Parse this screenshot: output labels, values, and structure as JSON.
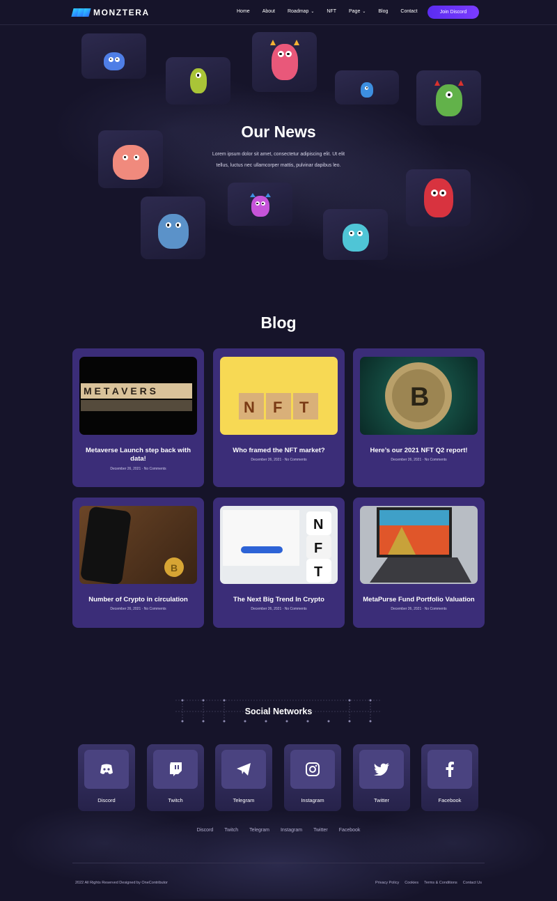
{
  "brand": {
    "name": "MONZTERA"
  },
  "nav": {
    "items": [
      {
        "label": "Home",
        "dropdown": false
      },
      {
        "label": "About",
        "dropdown": false
      },
      {
        "label": "Roadmap",
        "dropdown": true
      },
      {
        "label": "NFT",
        "dropdown": false
      },
      {
        "label": "Page",
        "dropdown": true
      },
      {
        "label": "Blog",
        "dropdown": false
      },
      {
        "label": "Contact",
        "dropdown": false
      }
    ],
    "cta": "Join Discord"
  },
  "news": {
    "title": "Our News",
    "description": "Lorem ipsum dolor sit amet, consectetur adipiscing elit. Ut elit tellus, luctus nec ullamcorper mattis, pulvinar dapibus leo."
  },
  "blog": {
    "title": "Blog",
    "posts": [
      {
        "title": "Metaverse Launch step back with data!",
        "date": "December 26, 2021",
        "comments": "No Comments",
        "image": "metaverse-blocks"
      },
      {
        "title": "Who framed the NFT market?",
        "date": "December 26, 2021",
        "comments": "No Comments",
        "image": "nft-blocks"
      },
      {
        "title": "Here’s our 2021 NFT Q2 report!",
        "date": "December 26, 2021",
        "comments": "No Comments",
        "image": "bitcoin-coin"
      },
      {
        "title": "Number of Crypto in circulation",
        "date": "December 26, 2021",
        "comments": "No Comments",
        "image": "phone-bitcoin"
      },
      {
        "title": "The Next Big Trend In Crypto",
        "date": "December 26, 2021",
        "comments": "No Comments",
        "image": "nft-dice"
      },
      {
        "title": "MetaPurse Fund Portfolio Valuation",
        "date": "December 26, 2021",
        "comments": "No Comments",
        "image": "laptop-art"
      }
    ]
  },
  "social": {
    "title": "Social Networks",
    "networks": [
      {
        "label": "Discord",
        "icon": "discord-icon"
      },
      {
        "label": "Twitch",
        "icon": "twitch-icon"
      },
      {
        "label": "Telegram",
        "icon": "telegram-icon"
      },
      {
        "label": "Instagram",
        "icon": "instagram-icon"
      },
      {
        "label": "Twitter",
        "icon": "twitter-icon"
      },
      {
        "label": "Facebook",
        "icon": "facebook-icon"
      }
    ],
    "links": [
      "Discord",
      "Twitch",
      "Telegram",
      "Instagram",
      "Twitter",
      "Facebook"
    ]
  },
  "footer": {
    "copyright": "2022 All Rights Reserved Designed by OneContributor",
    "legal": [
      "Privacy Policy",
      "Cookies",
      "Terms & Conditions",
      "Contact Us"
    ]
  },
  "colors": {
    "background": "#16142a",
    "card": "#3b2d78",
    "accent": "#6a34f8"
  }
}
